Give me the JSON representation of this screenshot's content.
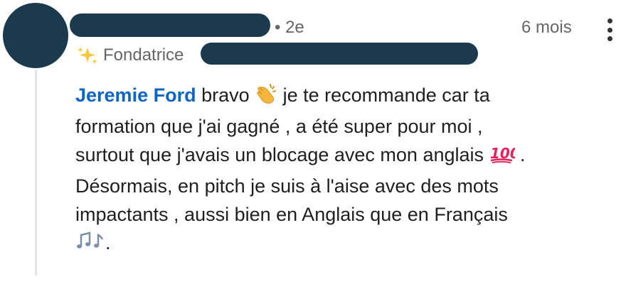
{
  "post": {
    "degree": "• 2e",
    "time": "6 mois",
    "headline_prefix": "Fondatrice",
    "more_icon": "more-vertical-icon",
    "colors": {
      "mention": "#0a66c2",
      "redaction": "#1b3a4e",
      "meta_text": "#666666",
      "thread_line": "#e3e3e3"
    }
  },
  "comment": {
    "mention": "Jeremie Ford",
    "line1": " bravo ",
    "line1b": " je te recommande car ta",
    "line2": "formation que j'ai gagné , a été super pour moi ,",
    "line3": "surtout que j'avais un blocage avec mon anglais ",
    "line3b": " .",
    "line4": "Désormais, en pitch je suis à l'aise avec des mots",
    "line5": "impactants , aussi bien en Anglais que en Français",
    "line6b": ".",
    "emojis": [
      "clapping-hands-emoji",
      "hundred-points-emoji",
      "musical-notes-emoji"
    ]
  }
}
